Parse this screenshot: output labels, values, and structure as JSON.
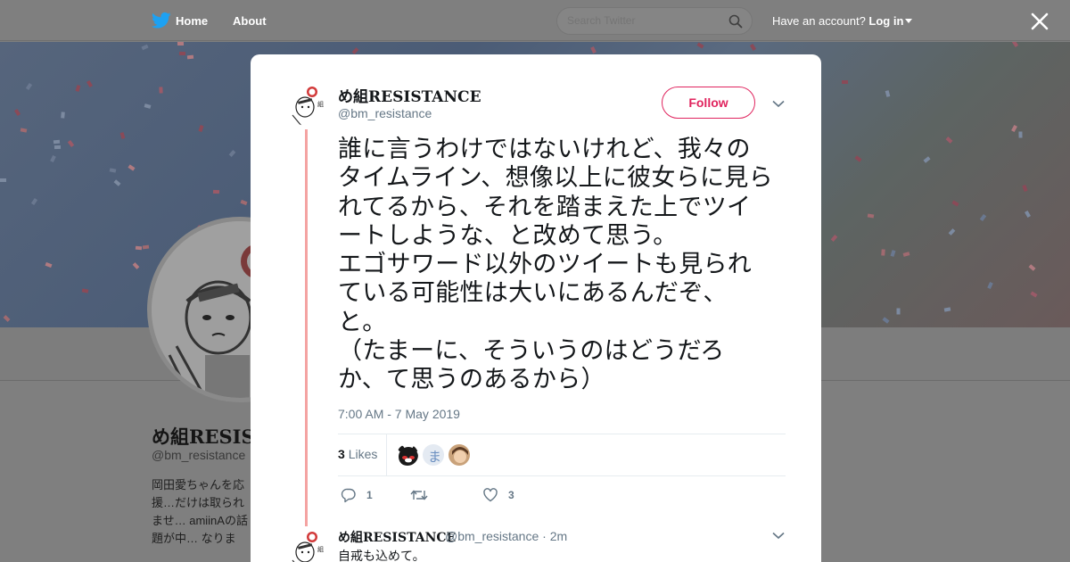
{
  "nav": {
    "home_label": "Home",
    "about_label": "About",
    "search_placeholder": "Search Twitter",
    "have_account": "Have an account?",
    "login_label": "Log in"
  },
  "profile": {
    "name": "め組RESISTANCE",
    "handle": "@bm_resistance",
    "bio": "岡田愛ちゃんを応援…だけは取られませ… amiinAの話題が中… なります。"
  },
  "tweet": {
    "author_name": "め組RESISTANCE",
    "author_handle": "@bm_resistance",
    "follow_label": "Follow",
    "text": "誰に言うわけではないけれど、我々の\nタイムライン、想像以上に彼女らに見ら\nれてるから、それを踏まえた上でツイ\nートしような、と改めて思う。\nエゴサワード以外のツイートも見られ\nている可能性は大いにあるんだぞ、\nと。\n（たまーに、そういうのはどうだろ\nか、て思うのあるから）",
    "timestamp": "7:00 AM - 7 May 2019",
    "likes_count": "3",
    "likes_label": "Likes",
    "reply_count": "1",
    "retweet_count": "",
    "like_count": "3"
  },
  "reply": {
    "author_name": "め組RESISTANCE",
    "author_handle_time": "@bm_resistance · 2m",
    "text": "自戒も込めて。"
  },
  "colors": {
    "accent": "#e0245e",
    "thread_line": "#f4a3a2",
    "twitter_blue": "#1da1f2",
    "meta_gray": "#657786"
  },
  "icons": [
    "twitter-bird-icon",
    "search-icon",
    "caret-down-icon",
    "close-icon",
    "chevron-down-icon",
    "reply-icon",
    "retweet-icon",
    "heart-icon"
  ]
}
